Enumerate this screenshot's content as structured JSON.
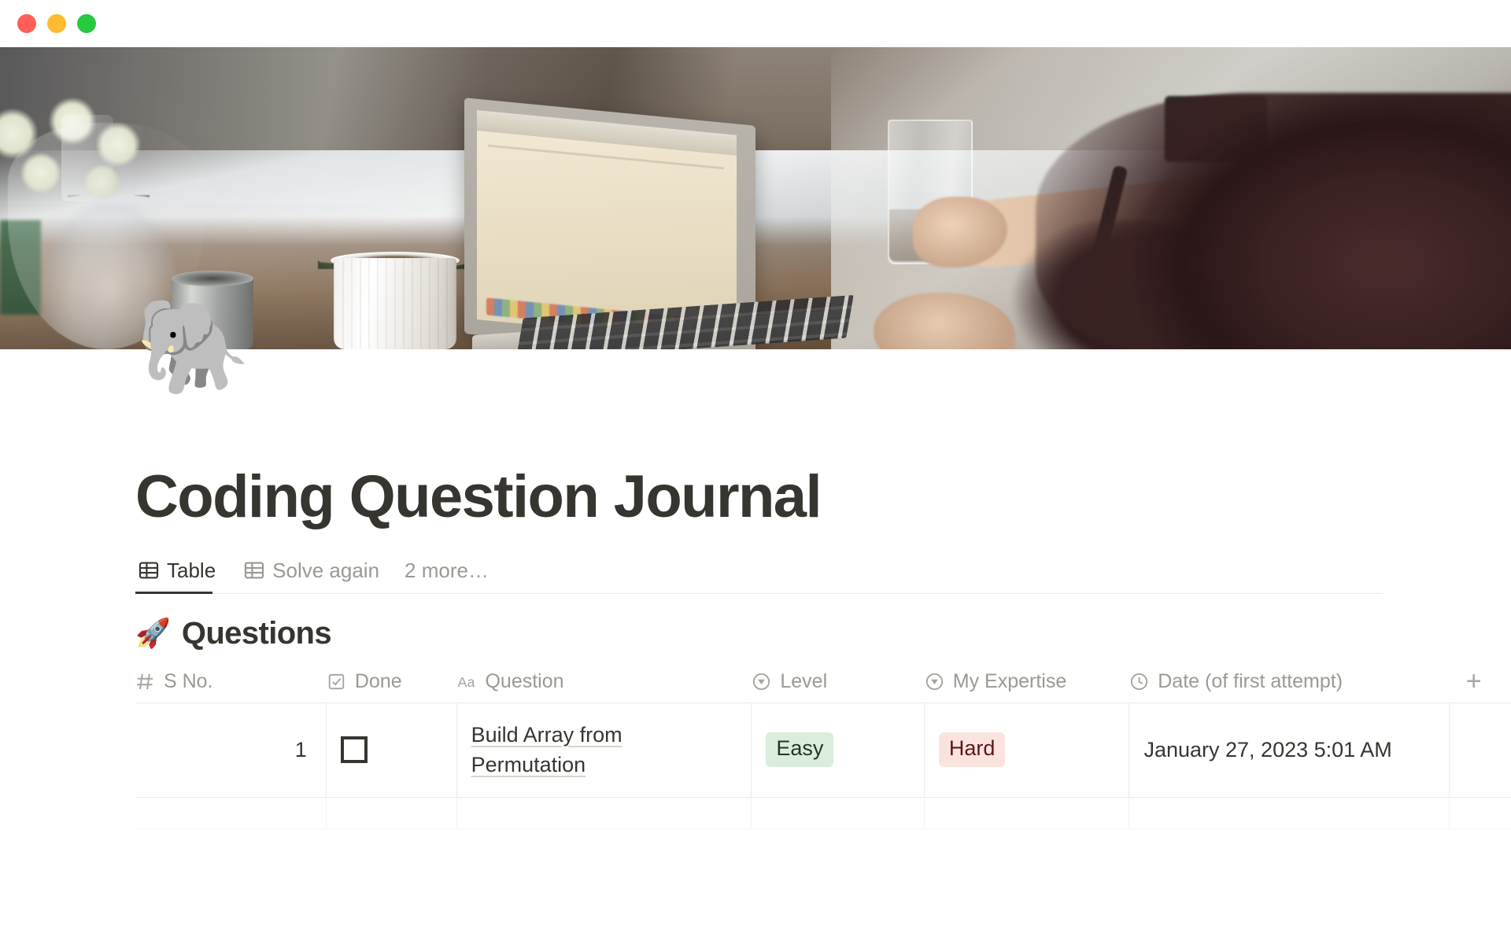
{
  "window": {
    "traffic_lights": [
      {
        "name": "close",
        "color": "#ff5f57"
      },
      {
        "name": "minimize",
        "color": "#febc2e"
      },
      {
        "name": "maximize",
        "color": "#28c840"
      }
    ]
  },
  "cover": {
    "alt": "Desk scene: white carnations in a glass vase, zebra succulent in a ribbed pot, pens in a steel cup, a MacBook Air, a glass of water and a person typing"
  },
  "page": {
    "icon": "🐘",
    "title": "Coding Question Journal"
  },
  "view_tabs": [
    {
      "label": "Table",
      "icon": "table-icon",
      "active": true
    },
    {
      "label": "Solve again",
      "icon": "table-icon",
      "active": false
    },
    {
      "label": "2 more…",
      "icon": "",
      "active": false
    }
  ],
  "database": {
    "emoji": "🚀",
    "title": "Questions",
    "add_column_label": "+",
    "columns": [
      {
        "key": "s_no",
        "label": "S No.",
        "icon": "number-icon"
      },
      {
        "key": "done",
        "label": "Done",
        "icon": "checkbox-icon"
      },
      {
        "key": "question",
        "label": "Question",
        "icon": "text-icon"
      },
      {
        "key": "level",
        "label": "Level",
        "icon": "select-icon"
      },
      {
        "key": "expertise",
        "label": "My Expertise",
        "icon": "select-icon"
      },
      {
        "key": "date",
        "label": "Date (of first attempt)",
        "icon": "clock-icon"
      }
    ],
    "rows": [
      {
        "s_no": "1",
        "done": false,
        "question": "Build Array from Permutation",
        "level": {
          "text": "Easy",
          "style": "green"
        },
        "expertise": {
          "text": "Hard",
          "style": "red"
        },
        "date": "January 27, 2023 5:01 AM"
      }
    ]
  },
  "colors": {
    "text_primary": "#37352f",
    "text_muted": "#9b9992",
    "border": "#eceae6",
    "pill_green_bg": "#dbeddb",
    "pill_green_fg": "#1c3829",
    "pill_red_bg": "#fbe4e0",
    "pill_red_fg": "#5d1715"
  }
}
